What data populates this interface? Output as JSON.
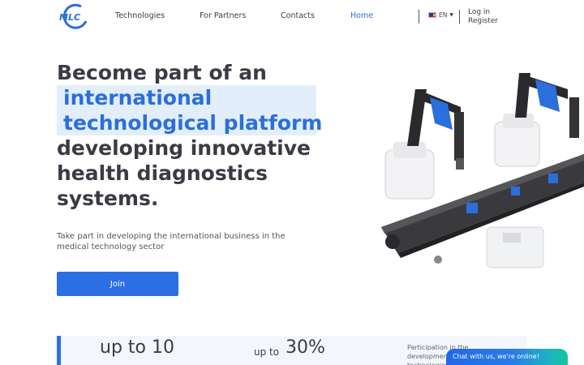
{
  "header": {
    "logo_text": "MLC",
    "nav": [
      {
        "label": "Technologies"
      },
      {
        "label": "For Partners"
      },
      {
        "label": "Contacts"
      },
      {
        "label": "Home"
      }
    ],
    "language": {
      "code": "EN",
      "flag_icon": "us-flag-icon"
    },
    "auth": {
      "login": "Log in",
      "register": "Register"
    },
    "active_color": "#2a6fdb"
  },
  "hero": {
    "title_line1": "Become part of an",
    "title_highlight1": "international",
    "title_highlight2": "technological platform",
    "title_line4": "developing innovative",
    "title_line5": "health diagnostics",
    "title_line6": "systems.",
    "subtitle": "Take part in developing the international business in the medical technology sector",
    "join_label": "Join",
    "accent": "#2c6fe3"
  },
  "stats": {
    "stat1_value": "up to 10",
    "stat1_more": "....",
    "stat2_prefix": "up to",
    "stat2_value": "30%",
    "stat3_text": "Participation in the development of technologies"
  },
  "chat": {
    "label": "Chat with us, we're online!"
  }
}
